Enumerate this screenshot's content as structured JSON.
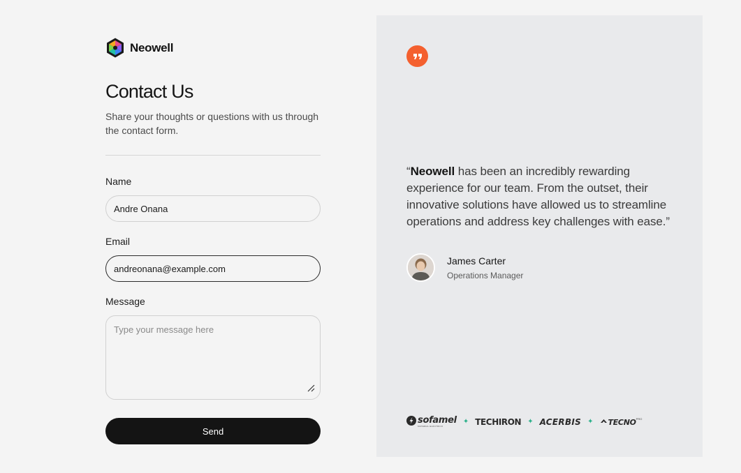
{
  "brand": {
    "name": "Neowell"
  },
  "form": {
    "title": "Contact Us",
    "subtitle": "Share your thoughts or questions with us through the contact form.",
    "name_label": "Name",
    "name_value": "Andre Onana",
    "email_label": "Email",
    "email_value": "andreonana@example.com",
    "message_label": "Message",
    "message_placeholder": "Type your message here",
    "send_label": "Send"
  },
  "testimonial": {
    "open_quote": "“",
    "company": "Neowell",
    "text": " has been an incredibly rewarding experience for our team. From the outset, their innovative solutions have allowed us to streamline operations and address key challenges with ease.”",
    "author_name": "James Carter",
    "author_role": "Operations Manager"
  },
  "partners": [
    {
      "name": "sofamel",
      "sub": "MATERIAL ELÉCTRICO"
    },
    {
      "name": "TECHIRON"
    },
    {
      "name": "ACERBIS"
    },
    {
      "name": "TECNO",
      "sup": "PRO"
    }
  ],
  "colors": {
    "accent": "#f4602f",
    "button": "#141414",
    "panel": "#e9eaec",
    "separator": "#2bb08a"
  }
}
